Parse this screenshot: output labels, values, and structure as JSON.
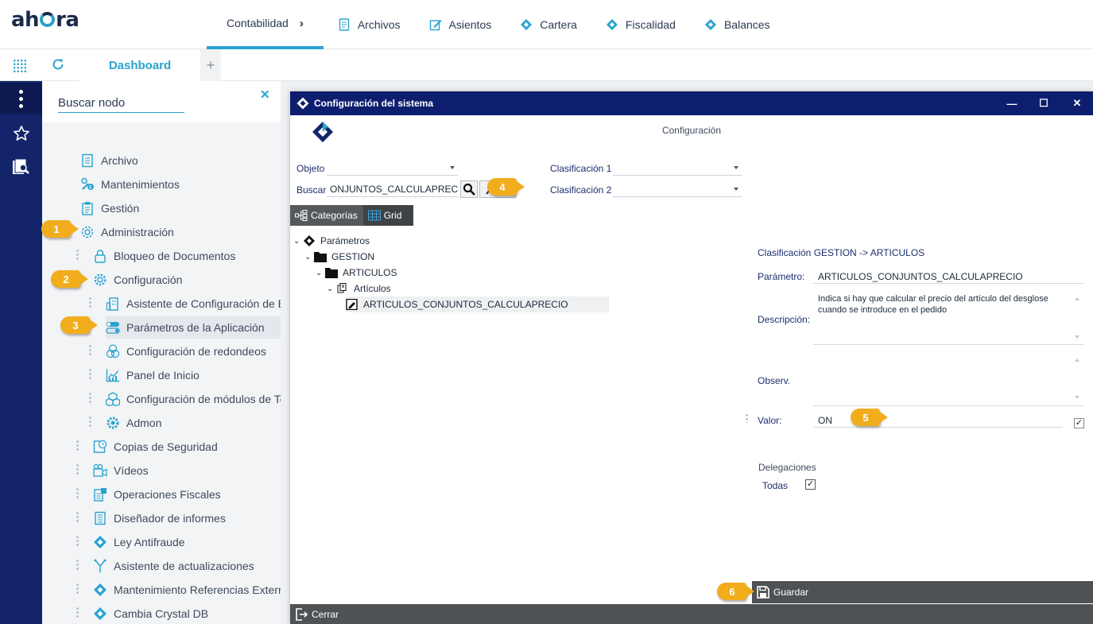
{
  "brand": {
    "logo_text_a": "ah",
    "logo_text_b": "ra"
  },
  "colors": {
    "accent": "#2aa3cf",
    "navy": "#13246b",
    "dialog_title": "#0e1e6e",
    "callout": "#f2ad1d"
  },
  "topnav": [
    {
      "label": "Contabilidad",
      "active": true
    },
    {
      "label": "Archivos",
      "icon": "document-icon"
    },
    {
      "label": "Asientos",
      "icon": "edit-icon"
    },
    {
      "label": "Cartera",
      "icon": "ahora-diamond-icon"
    },
    {
      "label": "Fiscalidad",
      "icon": "ahora-diamond-icon"
    },
    {
      "label": "Balances",
      "icon": "ahora-diamond-icon"
    }
  ],
  "tabbar": {
    "dashboard_label": "Dashboard",
    "add_label": "+"
  },
  "sidebar": {
    "search_placeholder": "Buscar nodo",
    "close_label": "✕",
    "items": [
      {
        "label": "Archivo",
        "icon": "document-icon"
      },
      {
        "label": "Mantenimientos",
        "icon": "tools-icon"
      },
      {
        "label": "Gestión",
        "icon": "clipboard-icon"
      },
      {
        "label": "Administración",
        "icon": "admin-gear-icon"
      },
      {
        "label": "Bloqueo de Documentos",
        "icon": "lock-icon"
      },
      {
        "label": "Configuración",
        "icon": "gear-icon"
      },
      {
        "label": "Asistente de Configuración de Em",
        "icon": "building-icon"
      },
      {
        "label": "Parámetros de la Aplicación",
        "icon": "toggle-icon"
      },
      {
        "label": "Configuración de redondeos",
        "icon": "coins-icon"
      },
      {
        "label": "Panel de Inicio",
        "icon": "chart-icon"
      },
      {
        "label": "Configuración de módulos de Tec",
        "icon": "cubes-icon"
      },
      {
        "label": "Admon",
        "icon": "cog-icon"
      },
      {
        "label": "Copias de Seguridad",
        "icon": "backup-icon"
      },
      {
        "label": "Vídeos",
        "icon": "video-icon"
      },
      {
        "label": "Operaciones Fiscales",
        "icon": "fiscal-icon"
      },
      {
        "label": "Diseñador de informes",
        "icon": "report-icon"
      },
      {
        "label": "Ley Antifraude",
        "icon": "ahora-diamond-icon"
      },
      {
        "label": "Asistente de actualizaciones",
        "icon": "branch-icon"
      },
      {
        "label": "Mantenimiento Referencias Externa",
        "icon": "ahora-diamond-icon"
      },
      {
        "label": "Cambia Crystal DB",
        "icon": "ahora-diamond-icon"
      }
    ]
  },
  "dialog": {
    "title": "Configuración del sistema",
    "heading": "Configuración",
    "controls": {
      "minimize": "—",
      "maximize": "☐",
      "close": "✕"
    },
    "objeto_label": "Objeto",
    "objeto_value": "",
    "buscar_label": "Buscar",
    "buscar_value": "ONJUNTOS_CALCULAPRECIO",
    "clasif1_label": "Clasificación 1",
    "clasif1_value": "",
    "clasif2_label": "Clasificación 2",
    "clasif2_value": "",
    "tabs": {
      "categorias": "Categorías",
      "grid": "Grid"
    },
    "tree": {
      "root": "Parámetros",
      "level1": "GESTION",
      "level2": "ARTICULOS",
      "level3": "Artículos",
      "leaf": "ARTICULOS_CONJUNTOS_CALCULAPRECIO"
    },
    "detail": {
      "classification": "Clasificación GESTION -> ARTICULOS",
      "parametro_label": "Parámetro:",
      "parametro_value": "ARTICULOS_CONJUNTOS_CALCULAPRECIO",
      "descripcion_label": "Descripción:",
      "descripcion_value": "Indica si hay que calcular el precio del artículo del desglose cuando se introduce en el pedido",
      "observ_label": "Observ.",
      "observ_value": "",
      "valor_label": "Valor:",
      "valor_value": "ON",
      "valor_checked": "✓",
      "delegaciones_label": "Delegaciones",
      "todas_label": "Todas",
      "todas_checked": "✓"
    },
    "save_label": "Guardar",
    "close_label": "Cerrar"
  },
  "callouts": [
    "1",
    "2",
    "3",
    "4",
    "5",
    "6"
  ]
}
